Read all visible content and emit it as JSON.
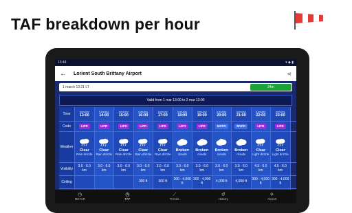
{
  "headline": "TAF breakdown per hour",
  "status": {
    "time": "13:44",
    "icons": "▾ ◆ ▮"
  },
  "appbar": {
    "title": "Lorient South Brittany Airport",
    "back_icon": "arrow-left-icon",
    "share_icon": "share-icon"
  },
  "date_row": {
    "date": "1 march 13:21 LT",
    "badge": "24m"
  },
  "valid_text": "Valid from 1 mar 13:00 to 2 mar 13:00",
  "labels": {
    "time": "Time",
    "code": "Code",
    "weather": "Weather",
    "visibility": "Visibility",
    "ceiling": "Ceiling"
  },
  "columns": [
    {
      "day": "tuesday",
      "time": "13:00",
      "code": "LIFR",
      "w1": "Clear",
      "w2": "Rain drizzle",
      "icon": "rain",
      "vis1": "3.0 - 6.0",
      "vis2": "km",
      "ceil1": "",
      "ceil2": ""
    },
    {
      "day": "tuesday",
      "time": "14:00",
      "code": "LIFR",
      "w1": "Clear",
      "w2": "Rain drizzle",
      "icon": "rain",
      "vis1": "3.0 - 6.0",
      "vis2": "km",
      "ceil1": "",
      "ceil2": ""
    },
    {
      "day": "tuesday",
      "time": "15:00",
      "code": "LIFR",
      "w1": "Clear",
      "w2": "Rain drizzle",
      "icon": "rain",
      "vis1": "3.0 - 6.0",
      "vis2": "km",
      "ceil1": "",
      "ceil2": ""
    },
    {
      "day": "tuesday",
      "time": "16:00",
      "code": "LIFR",
      "w1": "Clear",
      "w2": "Rain drizzle",
      "icon": "rain",
      "vis1": "3.0 - 6.0",
      "vis2": "km",
      "ceil1": "300 ft",
      "ceil2": ""
    },
    {
      "day": "tuesday",
      "time": "17:00",
      "code": "LIFR",
      "w1": "Clear",
      "w2": "Rain drizzle",
      "icon": "rain",
      "vis1": "3.0 - 6.0",
      "vis2": "km",
      "ceil1": "300 ft",
      "ceil2": ""
    },
    {
      "day": "tuesday",
      "time": "18:00",
      "code": "LIFR",
      "w1": "Broken",
      "w2": "clouds",
      "icon": "cloud",
      "vis1": "3.0 - 6.0",
      "vis2": "km",
      "ceil1": "300 - 4,000",
      "ceil2": "ft"
    },
    {
      "day": "tuesday",
      "time": "19:00",
      "code": "LIFR",
      "w1": "Broken",
      "w2": "clouds",
      "icon": "cloud",
      "vis1": "3.0 - 6.0",
      "vis2": "km",
      "ceil1": "300 - 4,000",
      "ceil2": "ft"
    },
    {
      "day": "tuesday",
      "time": "20:00",
      "code": "MVFR",
      "w1": "Broken",
      "w2": "clouds",
      "icon": "cloud",
      "vis1": "3.0 - 6.0",
      "vis2": "km",
      "ceil1": "4,000 ft",
      "ceil2": ""
    },
    {
      "day": "tuesday",
      "time": "21:00",
      "code": "MVFR",
      "w1": "Broken",
      "w2": "clouds",
      "icon": "cloud",
      "vis1": "3.0 - 6.0",
      "vis2": "km",
      "ceil1": "4,000 ft",
      "ceil2": ""
    },
    {
      "day": "tuesday",
      "time": "22:00",
      "code": "LIFR",
      "w1": "Clear",
      "w2": "Light drizzle",
      "icon": "rain",
      "vis1": "4.5 - 6.0",
      "vis2": "km",
      "ceil1": "300 - 4,000",
      "ceil2": "ft"
    },
    {
      "day": "tuesday",
      "time": "23:00",
      "code": "LIFR",
      "w1": "Clear",
      "w2": "Light drizzle",
      "icon": "rain",
      "vis1": "4.5 - 6.0",
      "vis2": "km",
      "ceil1": "300 - 4,000",
      "ceil2": "ft"
    }
  ],
  "colors": {
    "LIFR": "#9c2ce0",
    "MVFR": "#3a6cf4"
  },
  "nav": [
    {
      "label": "METAR",
      "icon": "clock-icon",
      "active": false
    },
    {
      "label": "TAF",
      "icon": "clock-icon",
      "active": true
    },
    {
      "label": "Trends",
      "icon": "trend-icon",
      "active": false
    },
    {
      "label": "History",
      "icon": "history-icon",
      "active": false
    },
    {
      "label": "Airport",
      "icon": "airport-icon",
      "active": false
    }
  ]
}
